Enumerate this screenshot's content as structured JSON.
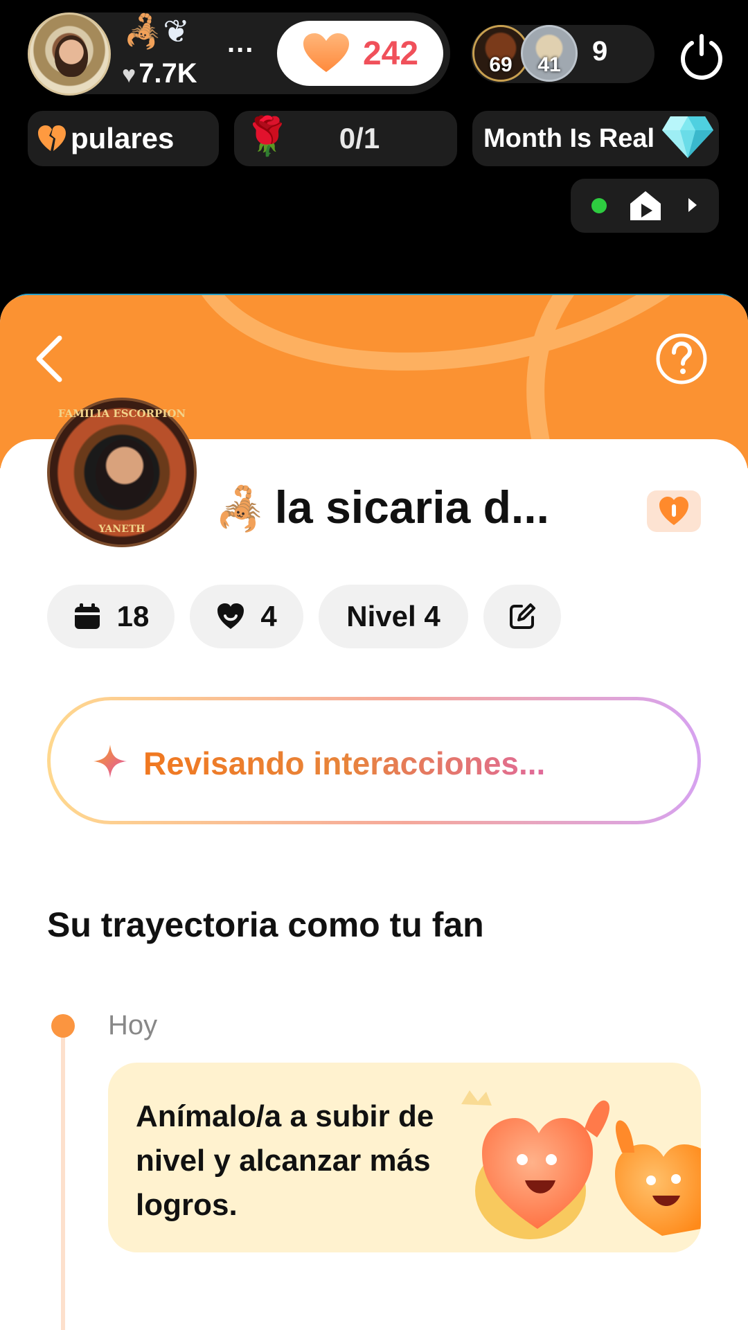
{
  "host": {
    "likes": "7.7K",
    "more_dots": "..."
  },
  "like_button": {
    "count": "242"
  },
  "viewers": {
    "first_level": "69",
    "second_level": "41",
    "count": "9"
  },
  "chips": {
    "popular_label": "pulares",
    "rose_value": "0/1",
    "month_label": "Month Is Real"
  },
  "sheet": {
    "fan_name": "la sicaria d...",
    "avatar_ring_top": "FAMILIA ESCORPION",
    "avatar_ring_bottom": "YANETH",
    "stats": {
      "days": "18",
      "hearts": "4",
      "level": "Nivel 4"
    },
    "ai_status": "Revisando interacciones...",
    "section_title": "Su trayectoria como tu fan",
    "timeline": {
      "date": "Hoy",
      "card_text": "Anímalo/a a subir de nivel y alcanzar más logros."
    }
  },
  "colors": {
    "header_orange": "#fb9232",
    "like_red": "#f0505a",
    "timeline_dot": "#fb9540",
    "card_bg": "#fff2cf",
    "live_green": "#2ecc40"
  },
  "icons": {
    "back": "chevron-left-icon",
    "help": "question-circle-icon",
    "calendar": "calendar-icon",
    "heart_face": "heart-smile-icon",
    "edit": "edit-icon",
    "sparkle": "sparkle-icon",
    "power": "power-icon",
    "house": "house-icon"
  }
}
